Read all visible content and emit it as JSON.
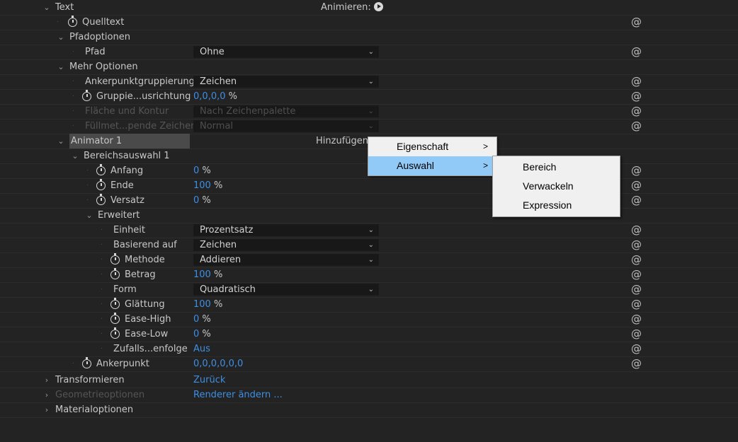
{
  "header": {
    "animate_label": "Animieren:"
  },
  "rows": {
    "text": "Text",
    "quelltext": "Quelltext",
    "pfadoptionen": "Pfadoptionen",
    "pfad": "Pfad",
    "pfad_value": "Ohne",
    "mehr_optionen": "Mehr Optionen",
    "ankerpunktgruppierung": "Ankerpunktgruppierung",
    "ankerpunktgruppierung_value": "Zeichen",
    "gruppierungsausrichtung": "Gruppie...usrichtung",
    "gruppierungsausrichtung_value": "0,0",
    "gruppierungsausrichtung_value2": "0,0",
    "flaeche_und_kontur": "Fläche und Kontur",
    "flaeche_und_kontur_value": "Nach Zeichenpalette",
    "fuellmethode": "Füllmet...pende Zeichen",
    "fuellmethode_value": "Normal",
    "animator1": "Animator 1",
    "add_label": "Hinzufügen:",
    "bereichsauswahl1": "Bereichsauswahl 1",
    "anfang": "Anfang",
    "anfang_value": "0",
    "ende": "Ende",
    "ende_value": "100",
    "versatz": "Versatz",
    "versatz_value": "0",
    "erweitert": "Erweitert",
    "einheit": "Einheit",
    "einheit_value": "Prozentsatz",
    "basierend_auf": "Basierend auf",
    "basierend_auf_value": "Zeichen",
    "methode": "Methode",
    "methode_value": "Addieren",
    "betrag": "Betrag",
    "betrag_value": "100",
    "form": "Form",
    "form_value": "Quadratisch",
    "glaettung": "Glättung",
    "glaettung_value": "100",
    "ease_high": "Ease-High",
    "ease_high_value": "0",
    "ease_low": "Ease-Low",
    "ease_low_value": "0",
    "zufallsreihenfolge": "Zufalls...enfolge",
    "zufallsreihenfolge_value": "Aus",
    "ankerpunkt": "Ankerpunkt",
    "ankerpunkt_value": "0,0,0,0,0,0",
    "transformieren": "Transformieren",
    "transformieren_value": "Zurück",
    "geometrieoptionen": "Geometrieoptionen",
    "geometrieoptionen_value": "Renderer ändern ...",
    "materialoptionen": "Materialoptionen"
  },
  "unit_percent": "%",
  "context_menu": {
    "items": [
      "Eigenschaft",
      "Auswahl"
    ],
    "submenu": [
      "Bereich",
      "Verwackeln",
      "Expression"
    ]
  },
  "icons": {
    "spiral": "expression-spiral-icon",
    "stopwatch": "stopwatch-icon",
    "chevron": "chevron-icon"
  },
  "colors": {
    "background": "#232323",
    "value_blue": "#3e8fe2",
    "menu_bg": "#f0f0f0",
    "menu_selected": "#91c9f7"
  }
}
